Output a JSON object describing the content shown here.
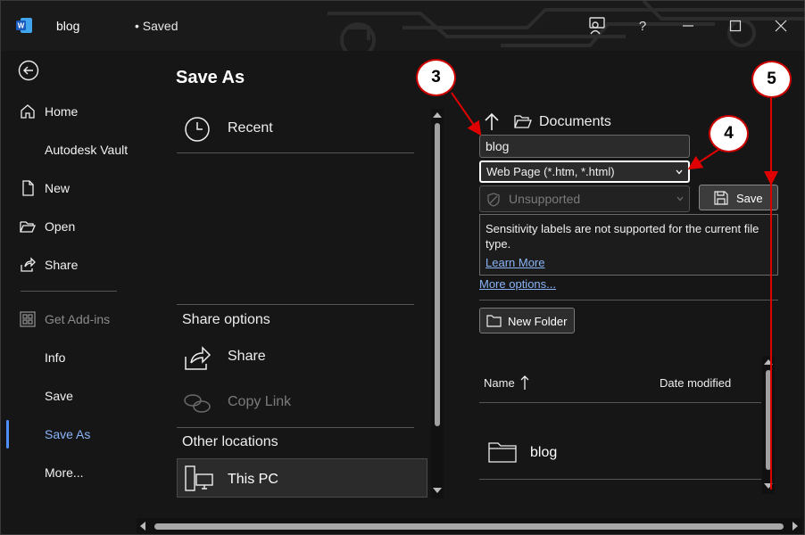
{
  "titlebar": {
    "doc_title": "blog",
    "status": "• Saved",
    "icons": [
      "word-logo",
      "presenter-icon",
      "help-icon",
      "minimize-icon",
      "maximize-icon",
      "close-icon"
    ],
    "help_glyph": "?"
  },
  "nav": {
    "items": [
      {
        "label": "Home",
        "icon": "home-icon"
      },
      {
        "label": "Autodesk Vault",
        "icon": ""
      },
      {
        "label": "New",
        "icon": "new-doc-icon"
      },
      {
        "label": "Open",
        "icon": "open-folder-icon"
      },
      {
        "label": "Share",
        "icon": "share-icon"
      },
      {
        "label": "Get Add-ins",
        "icon": "addins-icon",
        "disabled": true
      },
      {
        "label": "Info",
        "icon": ""
      },
      {
        "label": "Save",
        "icon": ""
      },
      {
        "label": "Save As",
        "icon": "",
        "active": true
      },
      {
        "label": "More...",
        "icon": ""
      }
    ]
  },
  "saveas": {
    "title": "Save As",
    "recent": "Recent",
    "share_options": "Share options",
    "share": "Share",
    "copy_link": "Copy Link",
    "other_locations": "Other locations",
    "this_pc": "This PC"
  },
  "right": {
    "breadcrumb": "Documents",
    "filename_value": "blog",
    "filetype_value": "Web Page (*.htm, *.html)",
    "sensitivity_value": "Unsupported",
    "save_label": "Save",
    "info_message": "Sensitivity labels are not supported for the current file type.",
    "learn_more": "Learn More",
    "more_options": "More options...",
    "new_folder": "New Folder",
    "col_name": "Name",
    "col_date": "Date modified",
    "files": [
      {
        "name": "blog",
        "icon": "folder-icon"
      }
    ]
  },
  "annotations": [
    "3",
    "4",
    "5"
  ],
  "colors": {
    "accent": "#4f8ef7",
    "link": "#8ab4f8",
    "annotation_border": "#cc0000",
    "arrow": "#e00000"
  }
}
